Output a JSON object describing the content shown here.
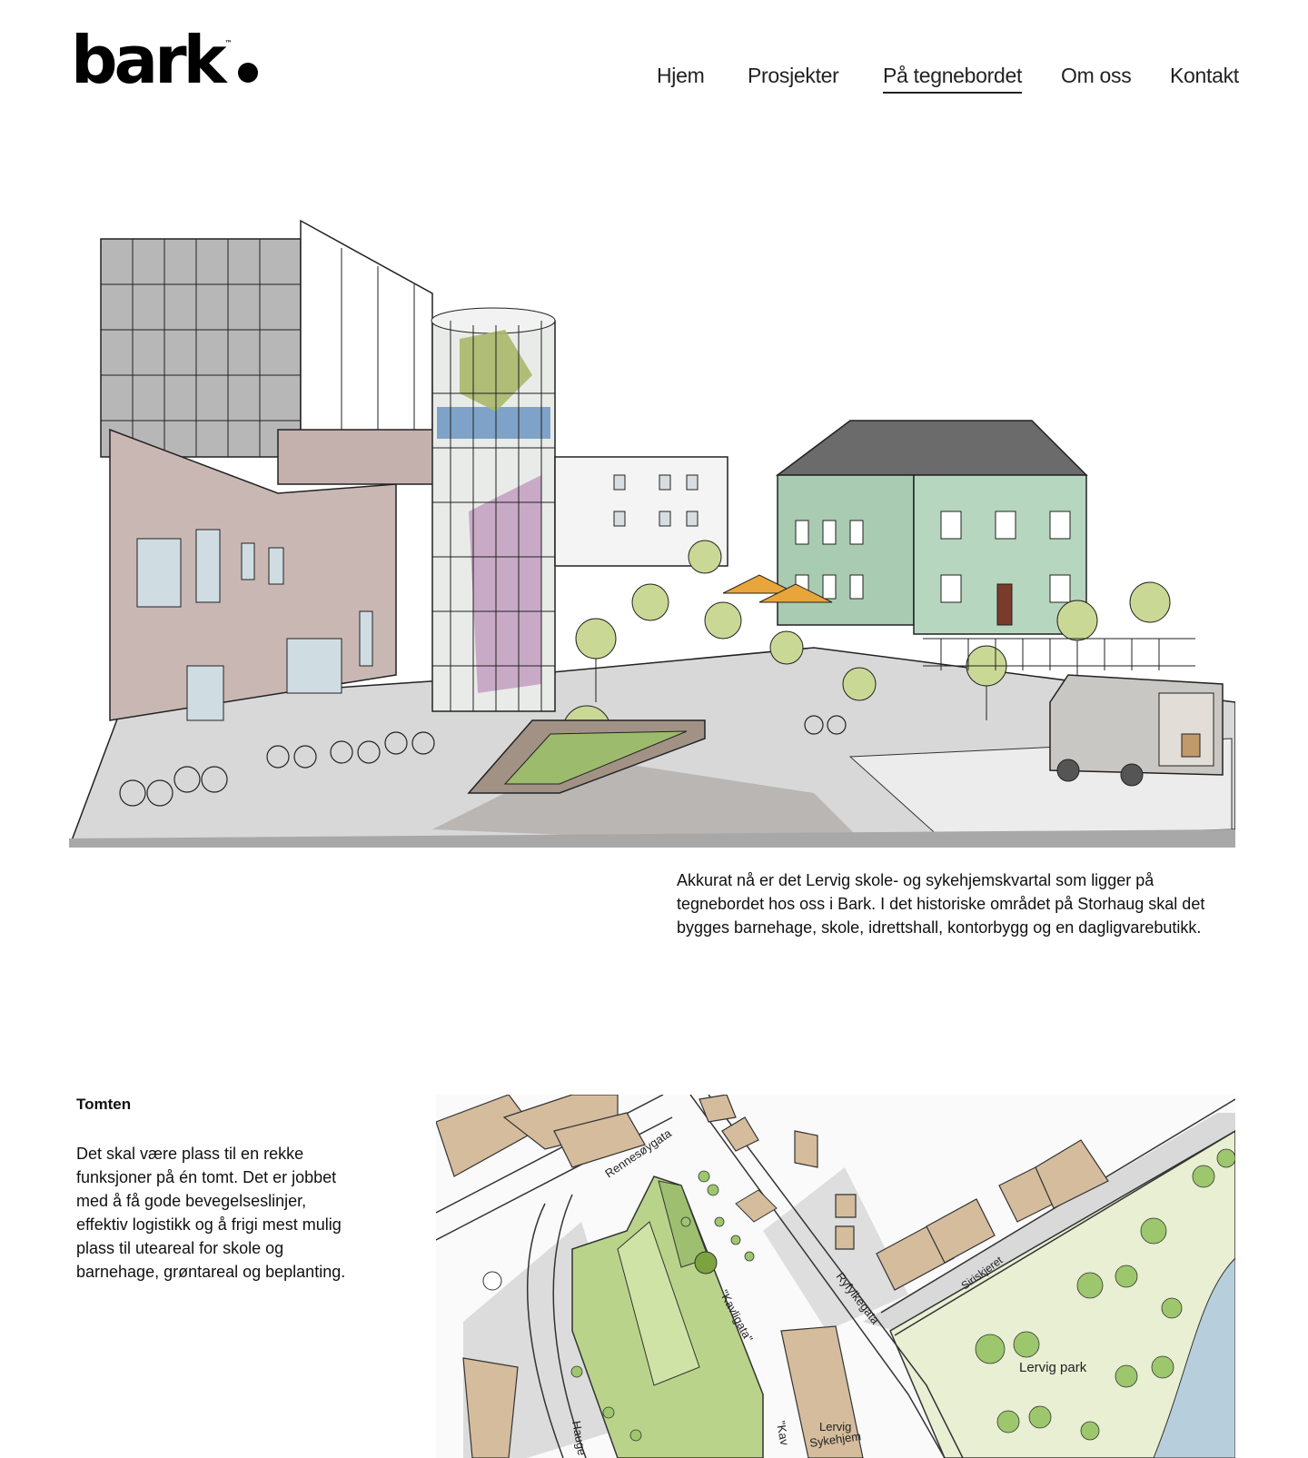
{
  "brand": {
    "name": "bark",
    "tm": "™"
  },
  "nav": {
    "items": [
      {
        "label": "Hjem"
      },
      {
        "label": "Prosjekter"
      },
      {
        "label": "På tegnebordet",
        "active": true
      },
      {
        "label": "Om oss"
      },
      {
        "label": "Kontakt"
      }
    ]
  },
  "intro": {
    "text": "Akkurat nå er det Lervig skole- og sykehjemskvartal som ligger på tegnebordet hos oss i Bark. I det historiske området på Storhaug skal det bygges barnehage, skole, idrettshall, kontorbygg og en dagligvarebutikk."
  },
  "site": {
    "title": "Tomten",
    "text": "Det skal være plass til en rekke funksjoner på én tomt. Det er jobbet med å få gode bevegelseslinjer, effektiv logistikk og å frigi mest mulig plass til uteareal for skole og barnehage, grøntareal og beplanting."
  },
  "map": {
    "labels": {
      "rennesoygata": "Rennesøygata",
      "kavligata": "\"Kavligata\"",
      "ryfylkegata": "Ryfylkegata",
      "siriskjeret": "Siriskjeret",
      "lervig_park": "Lervig park",
      "lervig_sykehjem_1": "Lervig",
      "lervig_sykehjem_2": "Sykehjem",
      "haug": "Hauge",
      "kav": "\"Kav"
    }
  }
}
